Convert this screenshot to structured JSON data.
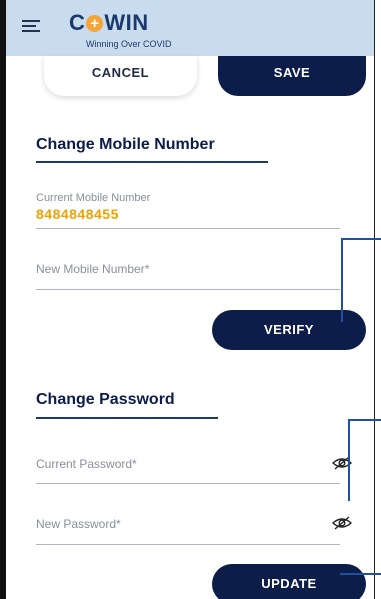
{
  "app": {
    "logo_text_left": "C",
    "logo_text_right": "WIN",
    "tagline": "Winning Over COVID"
  },
  "actions": {
    "cancel_label": "CANCEL",
    "save_label": "SAVE"
  },
  "mobile_section": {
    "title": "Change Mobile Number",
    "current_label": "Current Mobile Number",
    "current_value": "8484848455",
    "new_label": "New Mobile Number*",
    "verify_label": "VERIFY"
  },
  "password_section": {
    "title": "Change Password",
    "current_label": "Current Password*",
    "new_label": "New Password*",
    "update_label": "UPDATE"
  },
  "icons": {
    "menu": "hamburger-icon",
    "visibility": "eye-off-icon"
  },
  "colors": {
    "navy": "#0d1d4a",
    "header_bg": "#c9dcee",
    "accent_orange": "#f2a200",
    "connector_blue": "#1f4fa6"
  }
}
